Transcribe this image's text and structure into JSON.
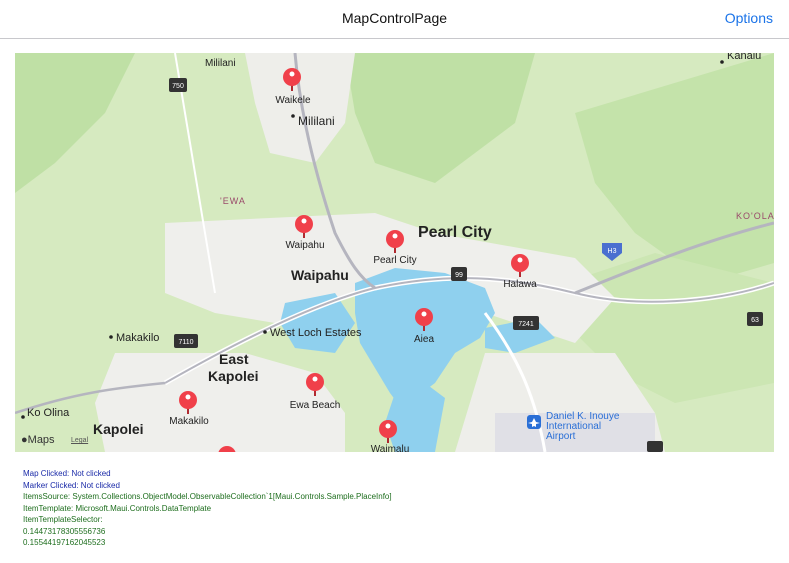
{
  "header": {
    "title": "MapControlPage",
    "options_label": "Options"
  },
  "map": {
    "places": {
      "mililani_top": "Mililani",
      "waikele": "Waikele",
      "mililani": "Mililani",
      "ewa_region": "'EWA",
      "waipahu_pin": "Waipahu",
      "waipahu_town": "Waipahu",
      "pearl_city_pin": "Pearl City",
      "pearl_city_big": "Pearl City",
      "halawa": "Halawa",
      "kanalu": "Kanalu",
      "koolau": "KO'OLA",
      "west_loch": "West Loch Estates",
      "makakilo_town": "Makakilo",
      "east_kapolei_1": "East",
      "east_kapolei_2": "Kapolei",
      "aiea": "Aiea",
      "ewa_beach": "Ewa Beach",
      "makakilo_pin": "Makakilo",
      "ko_olina": "Ko Olina",
      "kapolei": "Kapolei",
      "waimalu": "Waimalu",
      "airport_1": "Daniel K. Inouye",
      "airport_2": "International",
      "airport_3": "Airport"
    },
    "shields": {
      "r750": "750",
      "r99": "99",
      "r7241": "7241",
      "r7110": "7110",
      "h3": "H3",
      "r63": "63"
    },
    "logo": "Maps",
    "legal": "Legal"
  },
  "info": {
    "map_clicked": "Map Clicked: Not clicked",
    "marker_clicked": "Marker Clicked: Not clicked",
    "items_source": "ItemsSource: System.Collections.ObjectModel.ObservableCollection`1[Maui.Controls.Sample.PlaceInfo]",
    "item_template": "ItemTemplate: Microsoft.Maui.Controls.DataTemplate",
    "item_template_selector": "ItemTemplateSelector:",
    "value1": "0.14473178305556736",
    "value2": "0.15544197162045523"
  },
  "colors": {
    "accent": "#1a73e8",
    "pin": "#f0404a",
    "water": "#8fd0ee",
    "land": "#d9ebc4",
    "urban": "#efefec"
  }
}
